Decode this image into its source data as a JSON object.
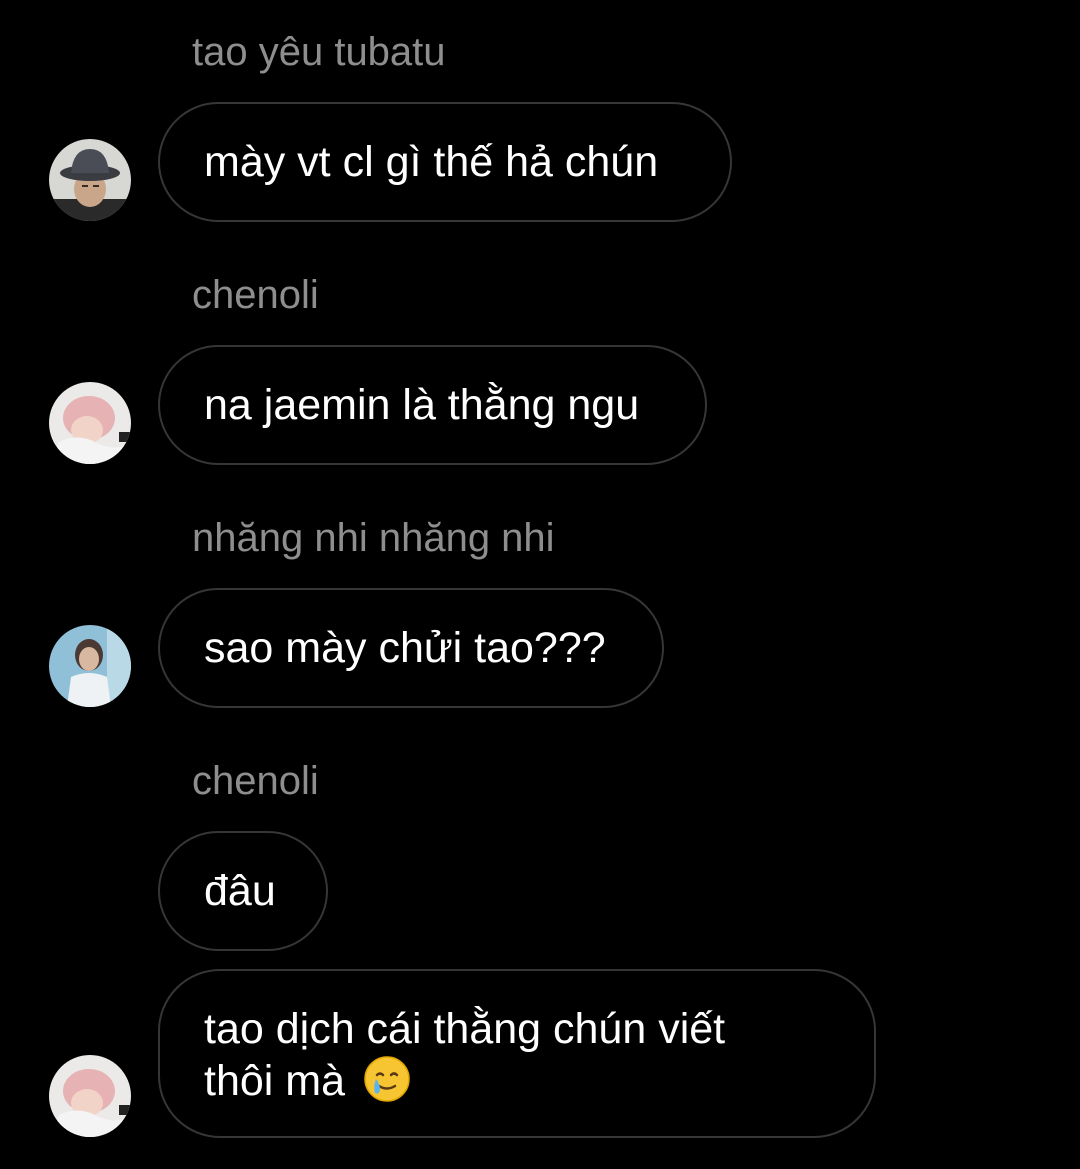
{
  "messages": [
    {
      "sender": "tao yêu tubatu",
      "text": "mày vt cl gì thế hả chún",
      "avatar": "avatar-bucket-hat"
    },
    {
      "sender": "chenoli",
      "text": "na jaemin là thằng ngu",
      "avatar": "avatar-pink-hair"
    },
    {
      "sender": "nhăng nhi nhăng nhi",
      "text": "sao mày chửi tao???",
      "avatar": "avatar-white-jacket"
    },
    {
      "sender": "chenoli",
      "text": "đâu",
      "avatar": null
    },
    {
      "sender": null,
      "text_line1": "tao dịch cái thằng chún viết",
      "text_line2": "thôi mà",
      "emoji": "crying-smile-emoji",
      "avatar": "avatar-pink-hair"
    }
  ],
  "colors": {
    "background": "#000000",
    "bubble_border": "#363636",
    "sender_text": "#8e8e8e",
    "message_text": "#ffffff"
  }
}
